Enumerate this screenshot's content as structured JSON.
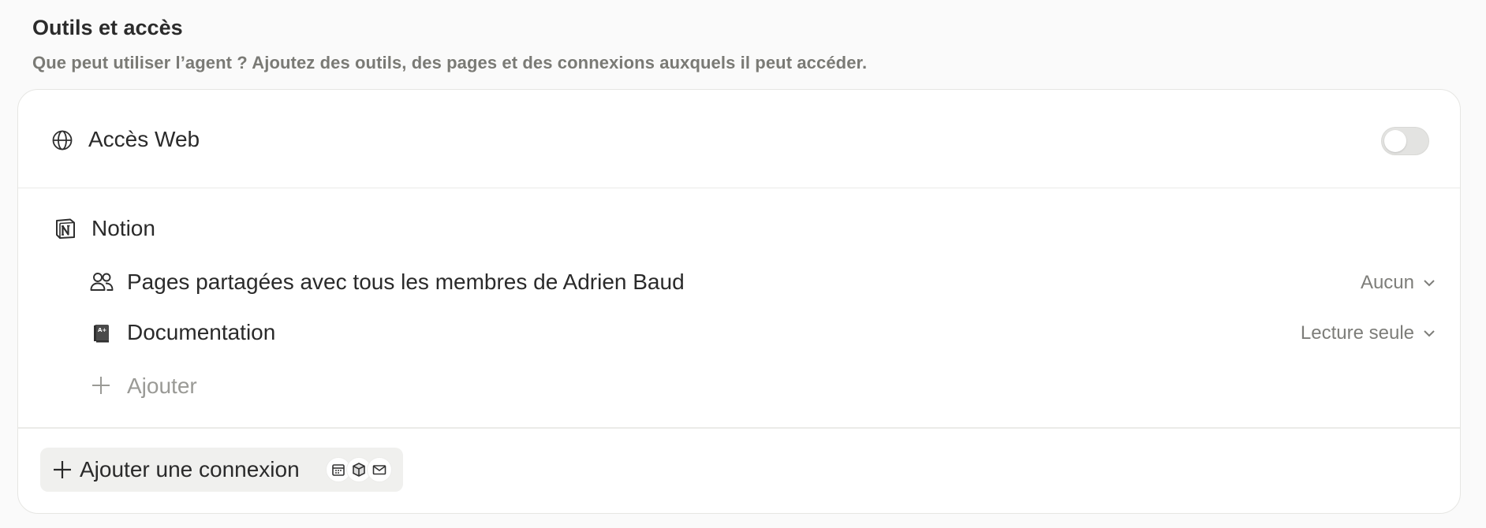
{
  "section": {
    "title": "Outils et accès",
    "subtitle": "Que peut utiliser l’agent ? Ajoutez des outils, des pages et des connexions auxquels il peut accéder."
  },
  "web_access": {
    "label": "Accès Web",
    "icon": "globe-icon",
    "enabled": false
  },
  "notion": {
    "label": "Notion",
    "icon": "notion-logo-icon",
    "items": [
      {
        "label": "Pages partagées avec tous les membres de Adrien Baud",
        "icon": "people-icon",
        "permission": "Aucun"
      },
      {
        "label": "Documentation",
        "icon": "book-icon",
        "permission": "Lecture seule"
      }
    ],
    "add_label": "Ajouter"
  },
  "add_connection": {
    "label": "Ajouter une connexion",
    "badge_icons": [
      "calendar-icon",
      "box-icon",
      "mail-icon"
    ]
  },
  "colors": {
    "text": "#2a2a2a",
    "muted": "#7d7d79",
    "placeholder": "#9a9a96",
    "card_bg": "#ffffff",
    "page_bg": "#fafafa",
    "toggle_off": "#e3e3e1"
  }
}
